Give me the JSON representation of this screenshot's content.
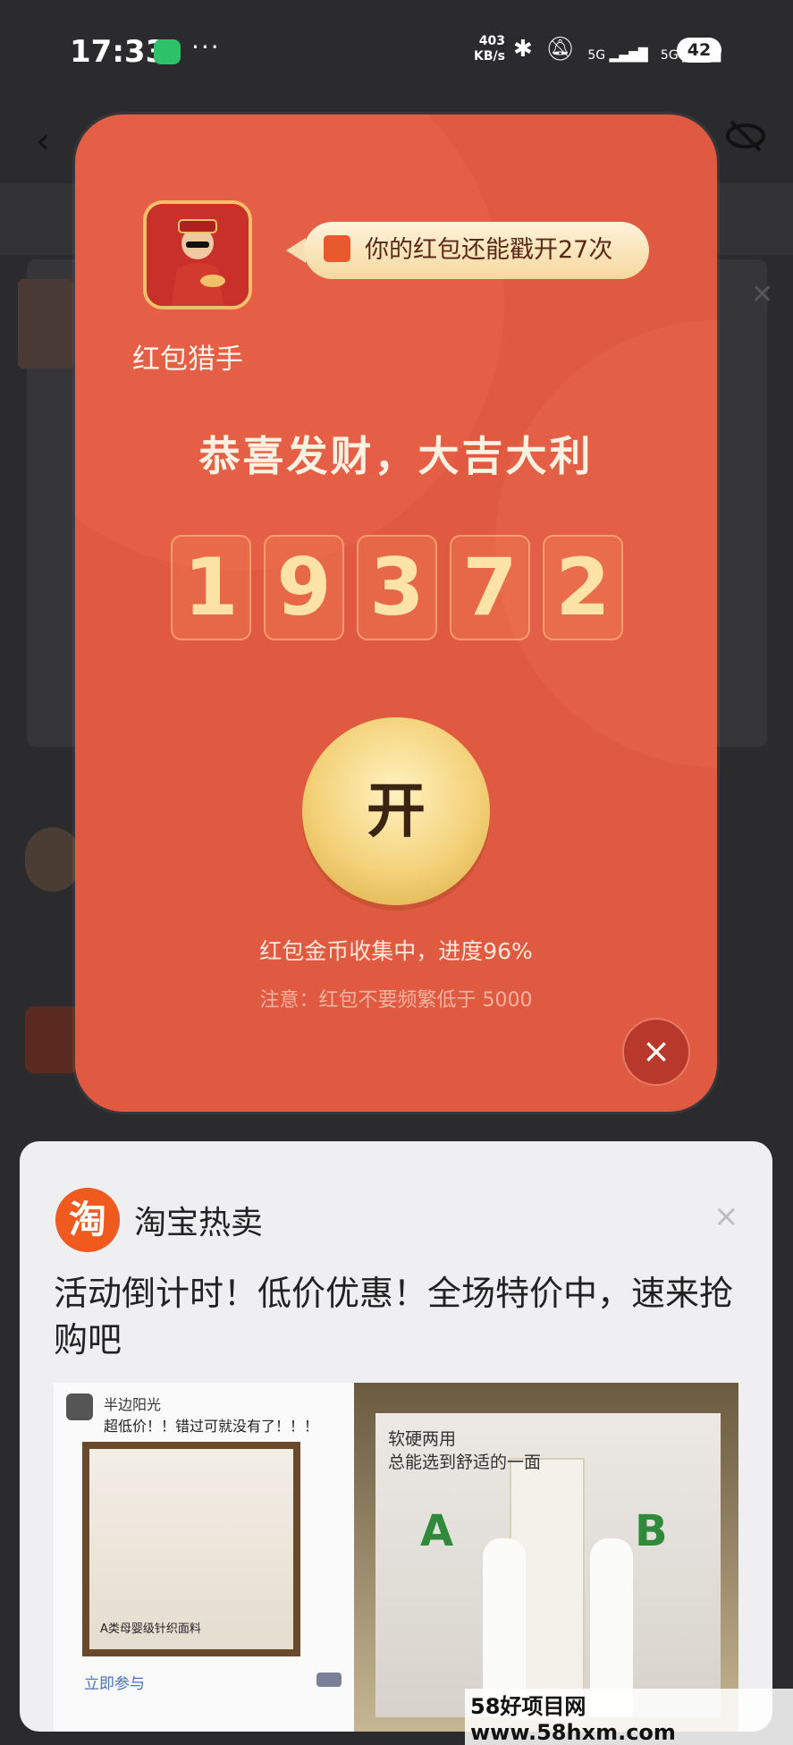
{
  "status_bar": {
    "time": "17:33",
    "net_speed_top": "403",
    "net_speed_bottom": "KB/s",
    "network_1": "5G",
    "network_2": "5G",
    "battery": "42"
  },
  "dialog": {
    "app_name": "红包猎手",
    "bubble_text": "你的红包还能戳开27次",
    "headline": "恭喜发财，大吉大利",
    "digits": [
      "1",
      "9",
      "3",
      "7",
      "2"
    ],
    "open_label": "开",
    "progress_text": "红包金币收集中，进度96%",
    "progress_percent": 96,
    "note_text": "注意：红包不要频繁低于 5000",
    "close_label": "×"
  },
  "ad": {
    "brand_logo_text": "淘",
    "brand_name": "淘宝热卖",
    "close_label": "×",
    "headline": "活动倒计时！低价优惠！全场特价中，速来抢购吧",
    "left_card": {
      "user_name": "半边阳光",
      "post_title": "超低价！！错过可就没有了！！！",
      "photo_caption": "A类母婴级针织面料",
      "cta": "立即参与"
    },
    "right_card": {
      "line1": "软硬两用",
      "line2": "总能选到舒适的一面",
      "label_a": "A",
      "label_b": "B"
    }
  },
  "watermark": "58好项目网www.58hxm.com",
  "colors": {
    "dialog_red": "#e05a42",
    "gold": "#f3d27a",
    "taobao_orange": "#f05a1e"
  }
}
